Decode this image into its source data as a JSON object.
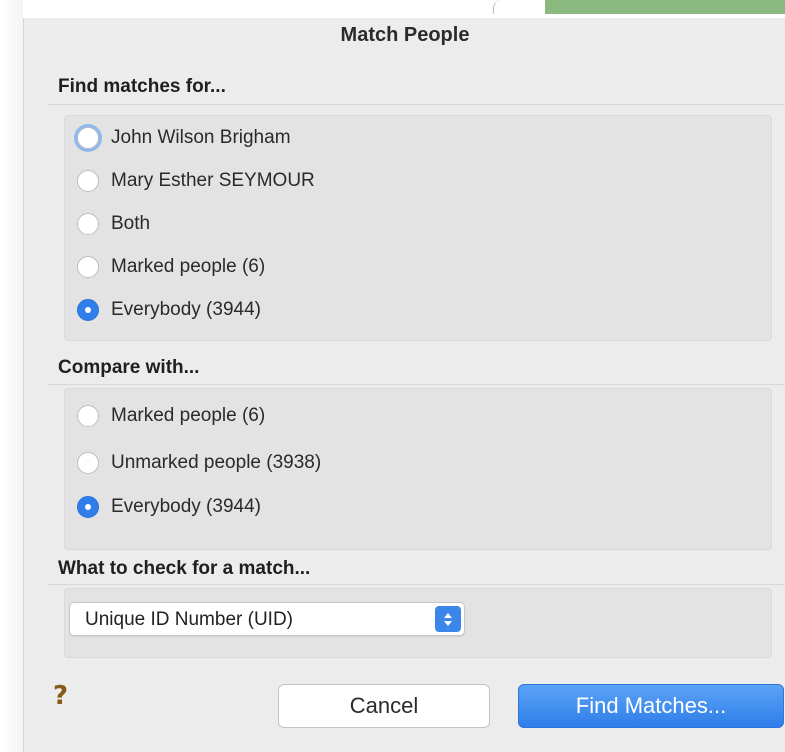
{
  "window": {
    "title": "Match People"
  },
  "find_matches": {
    "heading": "Find matches for...",
    "options": [
      {
        "label": "John Wilson Brigham",
        "checked": false,
        "focused": true
      },
      {
        "label": "Mary Esther SEYMOUR",
        "checked": false,
        "focused": false
      },
      {
        "label": "Both",
        "checked": false,
        "focused": false
      },
      {
        "label": "Marked people (6)",
        "checked": false,
        "focused": false
      },
      {
        "label": "Everybody (3944)",
        "checked": true,
        "focused": false
      }
    ]
  },
  "compare_with": {
    "heading": "Compare with...",
    "options": [
      {
        "label": "Marked people (6)",
        "checked": false
      },
      {
        "label": "Unmarked people (3938)",
        "checked": false
      },
      {
        "label": "Everybody (3944)",
        "checked": true
      }
    ]
  },
  "check_for_match": {
    "heading": "What to check for a match...",
    "selected": "Unique ID Number (UID)"
  },
  "footer": {
    "help_label": "?",
    "cancel_label": "Cancel",
    "find_label": "Find Matches..."
  },
  "colors": {
    "accent": "#2f7ee9",
    "dialog_bg": "#ececec",
    "group_bg": "#e3e3e3"
  }
}
